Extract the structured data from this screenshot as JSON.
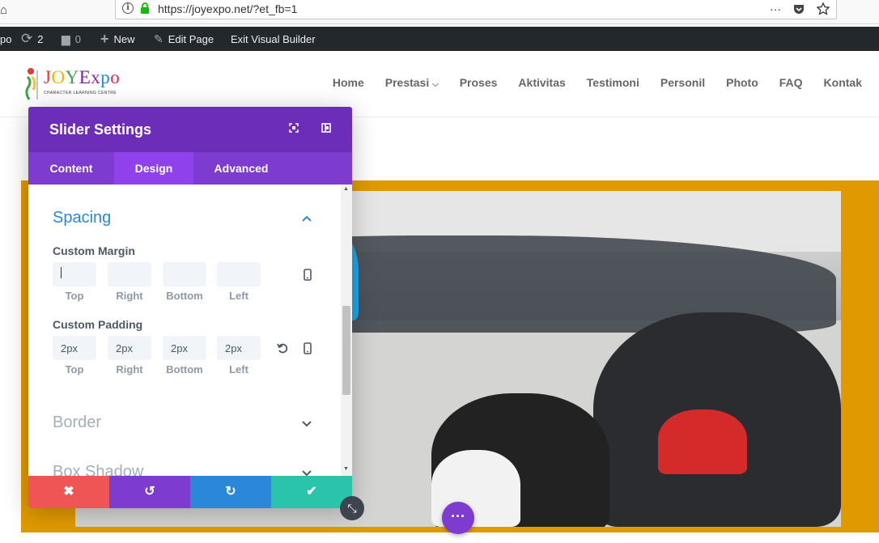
{
  "browser": {
    "url": "https://joyexpo.net/?et_fb=1",
    "more_icon": "···"
  },
  "admin_bar": {
    "site_fragment": "po",
    "updates_count": "2",
    "comments_count": "0",
    "new_label": "New",
    "edit_page_label": "Edit Page",
    "exit_label": "Exit Visual Builder"
  },
  "site": {
    "logo_text": "JOYExpo",
    "logo_subtitle": "CHARACTER LEARNING CENTRE",
    "nav": [
      "Home",
      "Prestasi",
      "Proses",
      "Aktivitas",
      "Testimoni",
      "Personil",
      "Photo",
      "FAQ",
      "Kontak"
    ]
  },
  "modal": {
    "title": "Slider Settings",
    "tabs": [
      "Content",
      "Design",
      "Advanced"
    ],
    "spacing": {
      "title": "Spacing",
      "margin_label": "Custom Margin",
      "padding_label": "Custom Padding",
      "captions": [
        "Top",
        "Right",
        "Bottom",
        "Left"
      ],
      "margin_values": [
        "",
        "",
        "",
        ""
      ],
      "padding_values": [
        "2px",
        "2px",
        "2px",
        "2px"
      ]
    },
    "collapsed_sections": [
      "Border",
      "Box Shadow"
    ],
    "footer_icons": [
      "✖",
      "↺",
      "↻",
      "✔"
    ]
  },
  "colors": {
    "accent_purple": "#7e3bd0",
    "header_purple": "#6c2eb9",
    "active_tab": "#8f42ec",
    "section_blue": "#2b87da",
    "collapsed_grey": "#a3aebb",
    "cancel_red": "#ef5555",
    "undo_purple": "#7e3bd0",
    "redo_blue": "#2b87da",
    "save_green": "#29c4a9",
    "slider_bg": "#e09a00"
  }
}
